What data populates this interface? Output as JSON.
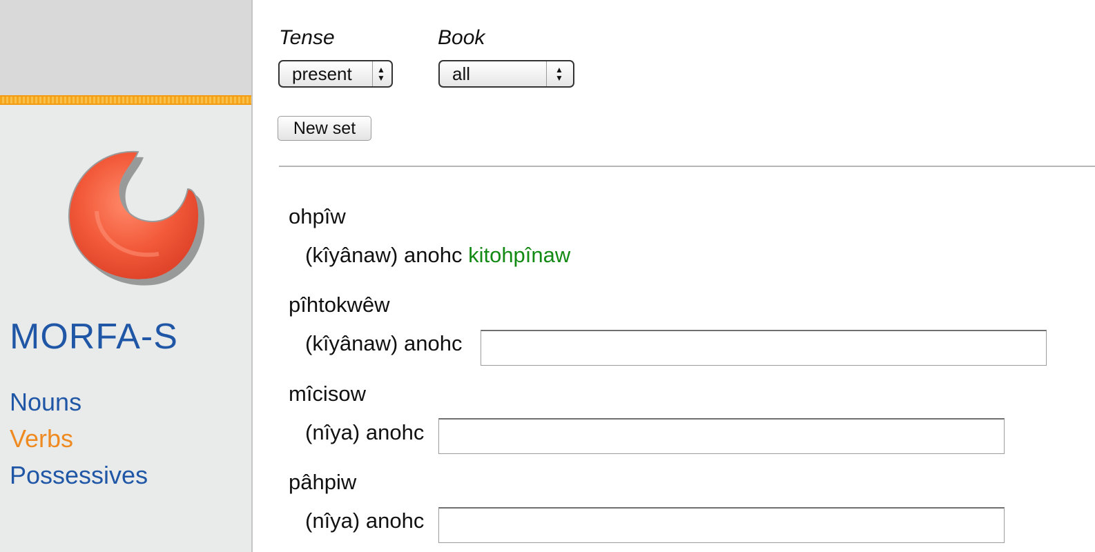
{
  "sidebar": {
    "site_title": "MORFA-S",
    "logo_icon": "red-crescent-logo-icon",
    "nav": [
      {
        "label": "Nouns",
        "active": false
      },
      {
        "label": "Verbs",
        "active": true
      },
      {
        "label": "Possessives",
        "active": false
      }
    ],
    "colors": {
      "link": "#1f57a6",
      "active": "#ee8a1f",
      "stripe": "#f5a61c"
    }
  },
  "filters": {
    "tense": {
      "label": "Tense",
      "selected": "present"
    },
    "book": {
      "label": "Book",
      "selected": "all"
    }
  },
  "actions": {
    "new_set_label": "New set"
  },
  "exercises": [
    {
      "verb": "ohpîw",
      "prompt": "(kîyânaw) anohc",
      "answer": "kitohpînaw",
      "value": ""
    },
    {
      "verb": "pîhtokwêw",
      "prompt": "(kîyânaw) anohc",
      "answer": "",
      "value": ""
    },
    {
      "verb": "mîcisow",
      "prompt": "(nîya) anohc",
      "answer": "",
      "value": ""
    },
    {
      "verb": "pâhpiw",
      "prompt": "(nîya) anohc",
      "answer": "",
      "value": ""
    }
  ],
  "colors": {
    "correct_answer": "#138a13"
  }
}
